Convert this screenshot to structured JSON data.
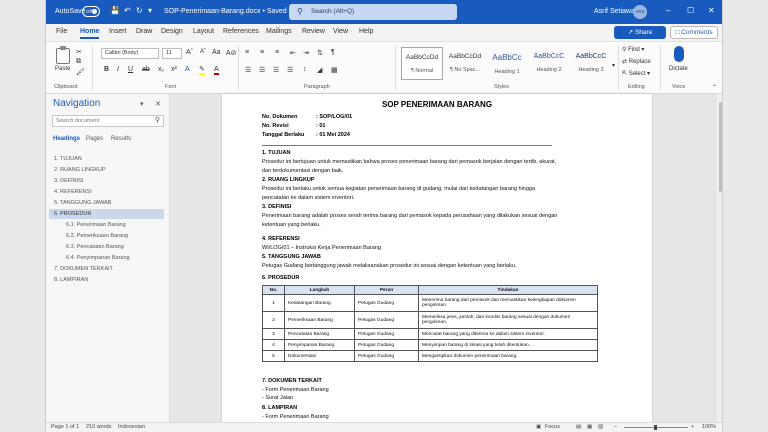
{
  "titlebar": {
    "autosave": "AutoSave",
    "toggle": "Off",
    "document_name": "SOP-Penerimaan-Barang.docx • Saved",
    "search_placeholder": "Search (Alt+Q)",
    "user_name": "Asrif Setiawan",
    "user_initials": "ARS"
  },
  "menu": {
    "tabs": [
      "File",
      "Home",
      "Insert",
      "Draw",
      "Design",
      "Layout",
      "References",
      "Mailings",
      "Review",
      "View",
      "Help"
    ],
    "active": "Home",
    "share": "Share",
    "comments": "Comments"
  },
  "ribbon": {
    "paste": "Paste",
    "font_name": "Calibri (Body)",
    "font_size": "11",
    "groups": [
      "Clipboard",
      "Font",
      "Paragraph",
      "Styles",
      "Editing",
      "Voice"
    ],
    "styles": [
      {
        "sample": "AaBbCcDd",
        "name": "¶ Normal"
      },
      {
        "sample": "AaBbCcDd",
        "name": "¶ No Spac..."
      },
      {
        "sample": "AaBbCc",
        "name": "Heading 1"
      },
      {
        "sample": "AaBbCcC",
        "name": "Heading 2"
      },
      {
        "sample": "AaBbCcC",
        "name": "Heading 3"
      }
    ],
    "editing": [
      "Find",
      "Replace",
      "Select"
    ],
    "dictate": "Dictate"
  },
  "navigation": {
    "title": "Navigation",
    "search_placeholder": "Search document",
    "tabs": [
      "Headings",
      "Pages",
      "Results"
    ],
    "items": [
      {
        "label": "1. TUJUAN",
        "sub": false
      },
      {
        "label": "2. RUANG LINGKUP",
        "sub": false
      },
      {
        "label": "3. DEFINISI",
        "sub": false
      },
      {
        "label": "4. REFERENSI",
        "sub": false
      },
      {
        "label": "5. TANGGUNG JAWAB",
        "sub": false
      },
      {
        "label": "6. PROSEDUR",
        "sub": false,
        "active": true
      },
      {
        "label": "6.1. Penerimaan Barang",
        "sub": true
      },
      {
        "label": "6.2. Pemeriksaan Barang",
        "sub": true
      },
      {
        "label": "6.3. Pencatatan Barang",
        "sub": true
      },
      {
        "label": "6.4. Penyimpanan Barang",
        "sub": true
      },
      {
        "label": "7. DOKUMEN TERKAIT",
        "sub": false
      },
      {
        "label": "8. LAMPIRAN",
        "sub": false
      }
    ]
  },
  "document": {
    "title": "SOP PENERIMAAN BARANG",
    "meta": [
      {
        "label": "No. Dokumen",
        "value": ": SOP/LOG/01"
      },
      {
        "label": "No. Revisi",
        "value": ": 01"
      },
      {
        "label": "Tanggal Berlaku",
        "value": ": 01 Mei 2024"
      }
    ],
    "s1_h": "1. TUJUAN",
    "s1_p": "Prosedur ini bertujuan untuk memastikan bahwa proses penerimaan barang dari pemasok berjalan dengan tertib, akurat, dan terdokumentasi dengan baik.",
    "s2_h": "2. RUANG LINGKUP",
    "s2_p": "Prosedur ini berlaku untuk semua kegiatan penerimaan barang di gudang, mulai dari kedatangan barang hingga pencatatan ke dalam sistem inventori.",
    "s3_h": "3. DEFINISI",
    "s3_p": "Penerimaan barang adalah proses serah terima barang dari pemasok kepada perusahaan yang dilakukan sesuai dengan ketentuan yang berlaku.",
    "s4_h": "4. REFERENSI",
    "s4_p": "WI/LOG/01 – Instruksi Kerja Penerimaan Barang",
    "s5_h": "5. TANGGUNG JAWAB",
    "s5_p": "Petugas Gudang bertanggung jawab melaksanakan prosedur ini sesuai dengan ketentuan yang berlaku.",
    "s6_h": "6. PROSEDUR",
    "table_headers": [
      "No.",
      "Langkah",
      "Peran",
      "Tindakan"
    ],
    "table_rows": [
      {
        "no": "1",
        "step": "Kedatangan Barang",
        "role": "Petugas Gudang",
        "action": "Menerima barang dari pemasok dan memastikan kelengkapan dokumen pengiriman."
      },
      {
        "no": "2",
        "step": "Pemeriksaan Barang",
        "role": "Petugas Gudang",
        "action": "Memeriksa jenis, jumlah, dan kondisi barang sesuai dengan dokumen pengiriman."
      },
      {
        "no": "3",
        "step": "Pencatatan Barang",
        "role": "Petugas Gudang",
        "action": "Mencatat barang yang diterima ke dalam sistem inventori."
      },
      {
        "no": "4",
        "step": "Penyimpanan Barang",
        "role": "Petugas Gudang",
        "action": "Menyimpan barang di lokasi yang telah ditentukan."
      },
      {
        "no": "5",
        "step": "Dokumentasi",
        "role": "Petugas Gudang",
        "action": "Mengarsipkan dokumen penerimaan barang."
      }
    ],
    "s7_h": "7. DOKUMEN TERKAIT",
    "s7_items": [
      "- Form Penerimaan Barang",
      "- Surat Jalan"
    ],
    "s8_h": "8. LAMPIRAN",
    "s8_items": [
      "- Form Penerimaan Barang"
    ]
  },
  "status": {
    "page": "Page 1 of 1",
    "words": "210 words",
    "language": "Indonesian",
    "focus": "Focus",
    "zoom": "100%"
  }
}
